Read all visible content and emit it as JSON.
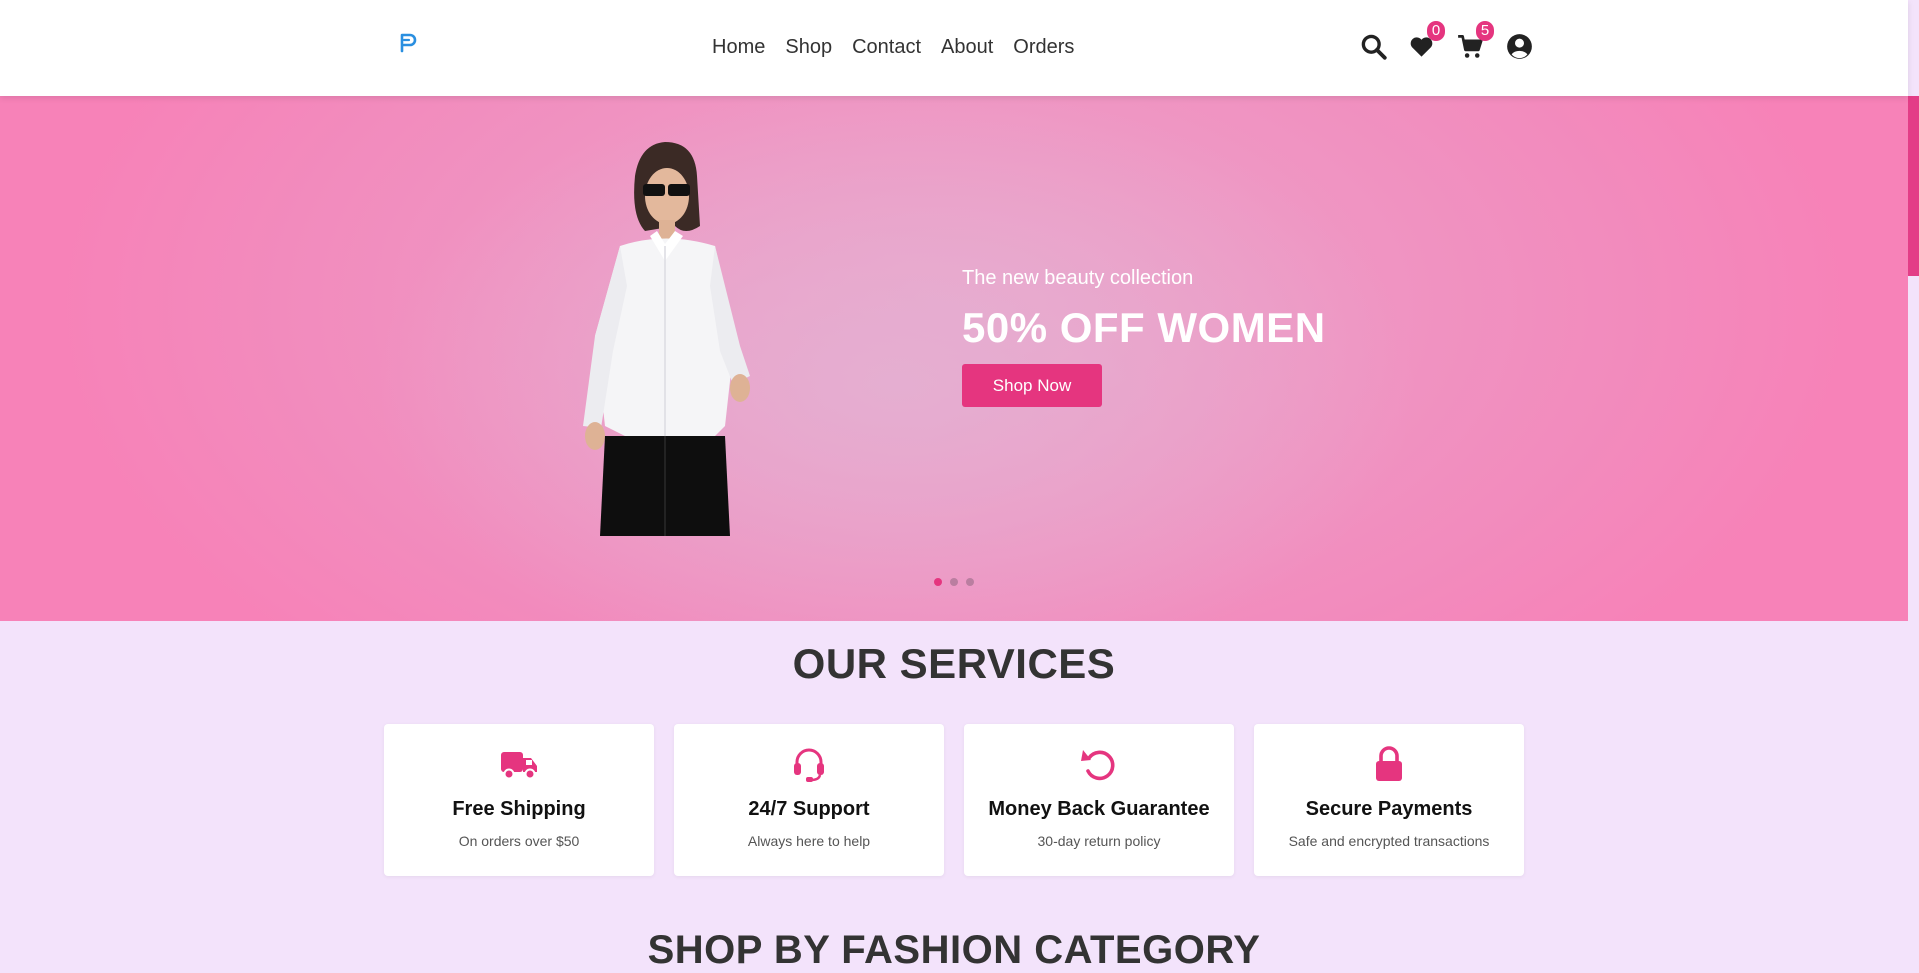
{
  "header": {
    "logo_icon": "p-logo-icon",
    "nav": [
      "Home",
      "Shop",
      "Contact",
      "About",
      "Orders"
    ],
    "icons": {
      "search": "search-icon",
      "wishlist": "heart-icon",
      "wishlist_count": "0",
      "cart": "cart-icon",
      "cart_count": "5",
      "account": "user-circle-icon"
    }
  },
  "hero": {
    "subtitle": "The new beauty collection",
    "title": "50% OFF WOMEN",
    "button": "Shop Now",
    "slides": 3,
    "active_slide": 1
  },
  "services": {
    "title": "OUR SERVICES",
    "items": [
      {
        "icon": "truck-icon",
        "title": "Free Shipping",
        "desc": "On orders over $50"
      },
      {
        "icon": "headset-icon",
        "title": "24/7 Support",
        "desc": "Always here to help"
      },
      {
        "icon": "undo-icon",
        "title": "Money Back Guarantee",
        "desc": "30-day return policy"
      },
      {
        "icon": "lock-icon",
        "title": "Secure Payments",
        "desc": "Safe and encrypted transactions"
      }
    ]
  },
  "categories": {
    "title": "SHOP BY FASHION CATEGORY"
  },
  "colors": {
    "accent": "#e5357f",
    "hero_bg": "#f28bbd",
    "page_bg": "#f3e3fb"
  }
}
